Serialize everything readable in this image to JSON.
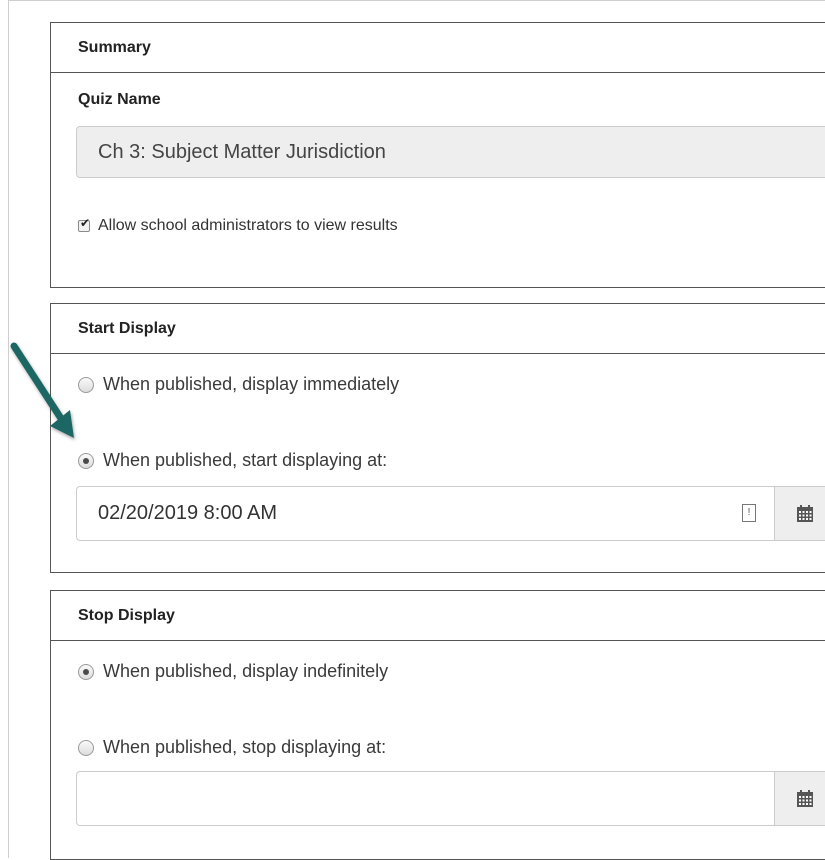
{
  "summary": {
    "heading": "Summary",
    "quiz_name_label": "Quiz Name",
    "quiz_name_value": "Ch 3: Subject Matter Jurisdiction",
    "allow_admins_label": "Allow school administrators to view results",
    "allow_admins_checked": true
  },
  "start_display": {
    "heading": "Start Display",
    "option_immediately": "When published, display immediately",
    "option_start_at": "When published, start displaying at:",
    "selected": "start_at",
    "date_value": "02/20/2019 8:00 AM"
  },
  "stop_display": {
    "heading": "Stop Display",
    "option_indefinitely": "When published, display indefinitely",
    "option_stop_at": "When published, stop displaying at:",
    "selected": "indefinitely",
    "date_value": ""
  },
  "icons": {
    "calendar": "calendar-icon",
    "annotation": "teal-arrow-pointer",
    "arrow_color": "#1f6663"
  }
}
